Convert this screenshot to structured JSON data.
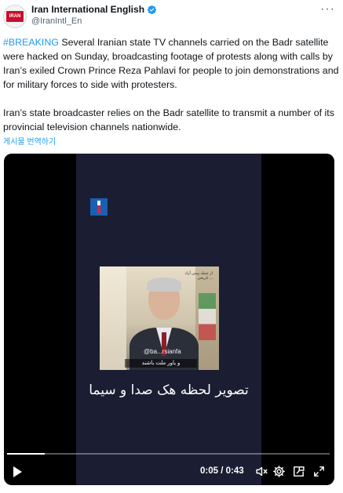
{
  "author": {
    "display_name": "Iran International English",
    "handle": "@IranIntl_En",
    "avatar_text": "IRAN"
  },
  "tweet": {
    "hashtag": "#BREAKING",
    "para1_rest": " Several Iranian state TV channels carried on the Badr satellite were hacked on Sunday, broadcasting footage of protests along with calls by Iran’s exiled Crown Prince Reza Pahlavi for people to join demonstrations and for military forces to side with protesters.",
    "para2": "Iran’s state broadcaster relies on the Badr satellite to transmit a number of its provincial television channels nationwide.",
    "translate_label": "게시물 번역하기"
  },
  "more_label": "···",
  "video": {
    "inset_watermark": "@ba...rsianfa",
    "inset_caption": "و یاور ملت باشند",
    "inset_top_text": "از جمله پیمی آزاد تاریخی ...",
    "burned_caption": "تصویر لحظه هک صدا و سیما",
    "time_current": "0:05",
    "time_separator": " / ",
    "time_total": "0:43",
    "progress_fraction": 0.116
  },
  "icons": {
    "verified": "verified-badge-icon",
    "play": "play-icon",
    "volume": "volume-muted-icon",
    "settings": "settings-gear-icon",
    "pip": "picture-in-picture-icon",
    "fullscreen": "fullscreen-icon"
  },
  "colors": {
    "accent": "#1d9bf0",
    "text": "#0f1419",
    "secondary": "#536471"
  }
}
